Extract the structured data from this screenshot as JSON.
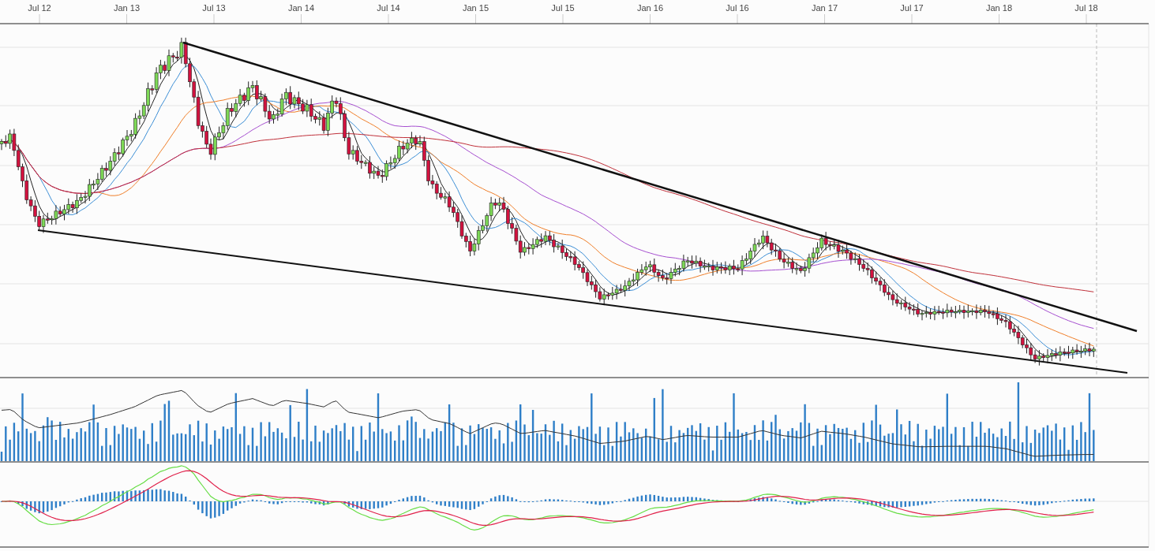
{
  "x_axis_labels": [
    "Jul 12",
    "Jan 13",
    "Jul 13",
    "Jan 14",
    "Jul 14",
    "Jan 15",
    "Jul 15",
    "Jan 16",
    "Jul 16",
    "Jan 17",
    "Jul 17",
    "Jan 18",
    "Jul 18"
  ]
}
